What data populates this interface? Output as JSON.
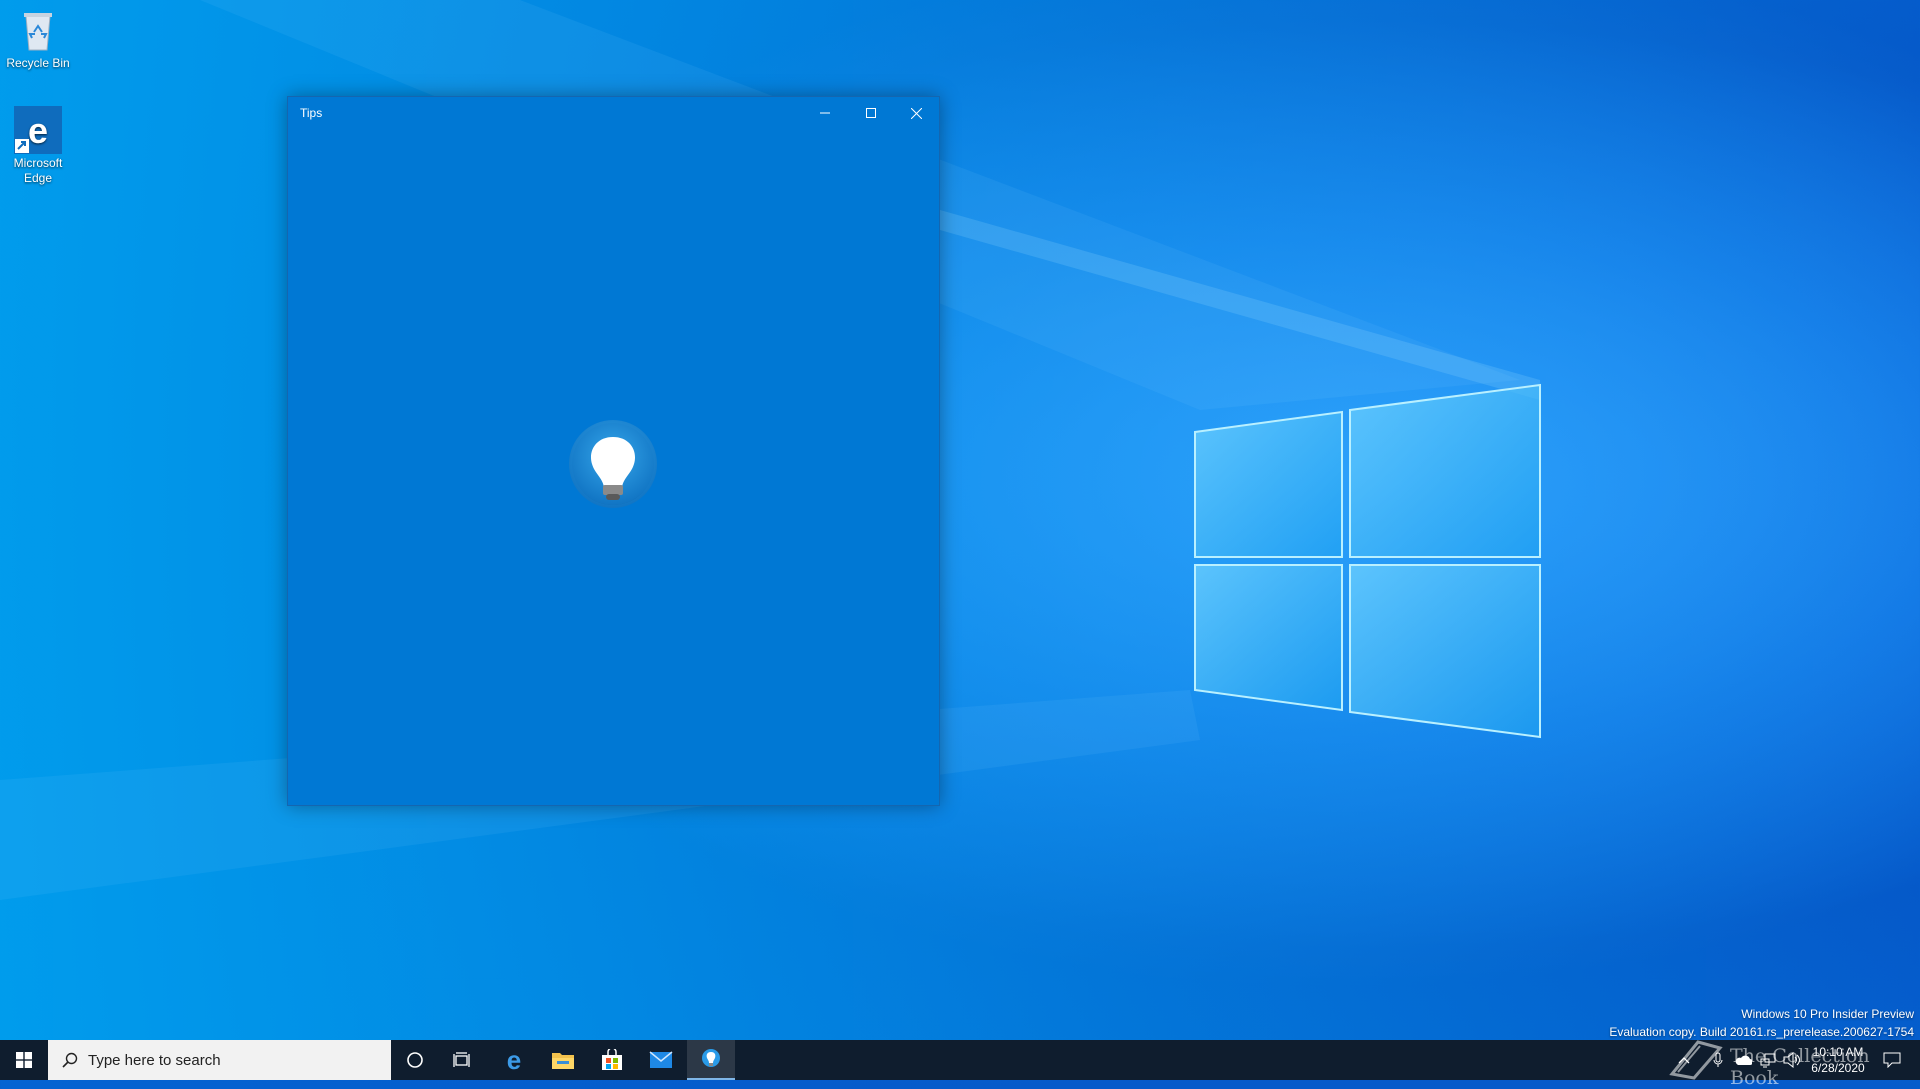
{
  "desktop": {
    "icons": [
      {
        "label": "Recycle Bin"
      },
      {
        "label": "Microsoft Edge"
      }
    ]
  },
  "window": {
    "title": "Tips",
    "background_color": "#0078d4",
    "controls": [
      "minimize-icon",
      "maximize-icon",
      "close-icon"
    ],
    "splash_icon": "lightbulb-icon"
  },
  "watermark": {
    "line1": "Windows 10 Pro Insider Preview",
    "line2": "Evaluation copy. Build 20161.rs_prerelease.200627-1754"
  },
  "taskbar": {
    "search_placeholder": "Type here to search",
    "pinned": [
      "cortana-icon",
      "task-view-icon",
      "edge-icon",
      "file-explorer-icon",
      "store-icon",
      "mail-icon",
      "tips-icon"
    ],
    "active": "tips-icon",
    "tray": {
      "time": "10:10 AM",
      "date": "6/28/2020"
    },
    "brand_overlay": "The Collection Book"
  }
}
